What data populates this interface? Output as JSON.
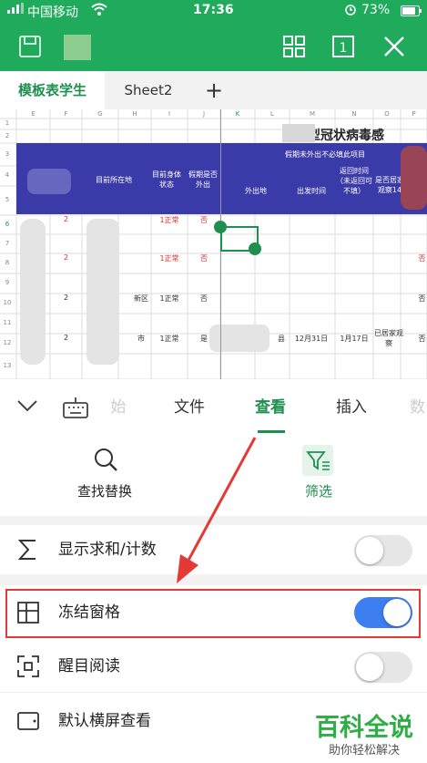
{
  "status_bar": {
    "carrier": "中国移动",
    "time": "17:36",
    "battery": "73%"
  },
  "sheet_tabs": {
    "active": "模板表学生",
    "other": "Sheet2",
    "add": "+"
  },
  "toolbar_tabs": {
    "partial_left": "始",
    "file": "文件",
    "view": "查看",
    "insert": "插入",
    "partial_right": "数"
  },
  "quick_actions": {
    "find_replace": "查找替换",
    "filter": "筛选"
  },
  "settings": [
    {
      "label": "显示求和/计数",
      "on": false
    },
    {
      "label": "冻结窗格",
      "on": true
    },
    {
      "label": "醒目阅读",
      "on": false
    },
    {
      "label": "默认横屏查看",
      "on": false
    }
  ],
  "watermark": {
    "title": "百科全说",
    "subtitle": "助你轻松解决"
  },
  "spreadsheet": {
    "col_headers": [
      "E",
      "F",
      "G",
      "H",
      "I",
      "J",
      "K",
      "L",
      "M",
      "N",
      "O",
      "P"
    ],
    "row_headers": [
      "1",
      "2",
      "3",
      "4",
      "5",
      "6",
      "7",
      "8",
      "9",
      "10",
      "11",
      "12",
      "13"
    ],
    "title": "对新型冠状病毒感",
    "header_current_location": "目前所在地",
    "header_health": "目前身体状态",
    "header_outing": "假期是否外出",
    "header_holiday": "假期未外出不必填此项目",
    "header_destination": "外出地",
    "header_depart": "出发时间",
    "header_return": "返回时间（未返回可不填）",
    "header_quarantine": "是否居家观察14",
    "v_2": "2",
    "v_normal": "1正常",
    "v_no": "否",
    "v_yes": "是",
    "v_district": "新区",
    "v_city": "市",
    "v_county": "县",
    "v_date1": "12月31日",
    "v_date2": "1月17日",
    "v_observe": "已居家观察",
    "v_no_edge": "否"
  }
}
